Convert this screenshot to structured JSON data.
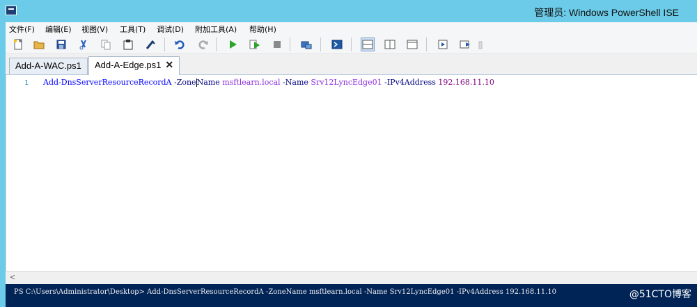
{
  "window": {
    "title": "管理员: Windows PowerShell ISE"
  },
  "menu": [
    {
      "label": "文件(F)"
    },
    {
      "label": "编辑(E)"
    },
    {
      "label": "视图(V)"
    },
    {
      "label": "工具(T)"
    },
    {
      "label": "调试(D)"
    },
    {
      "label": "附加工具(A)"
    },
    {
      "label": "帮助(H)"
    }
  ],
  "toolbar": {
    "icons": [
      "new-icon",
      "open-icon",
      "save-icon",
      "cut-icon",
      "copy-icon",
      "paste-icon",
      "clear-icon",
      "undo-icon",
      "redo-icon",
      "run-icon",
      "run-selection-icon",
      "stop-icon",
      "remote-icon",
      "powershell-icon",
      "layout-top-icon",
      "layout-right-icon",
      "layout-max-icon",
      "command-addon-icon",
      "show-script-icon"
    ]
  },
  "tabs": [
    {
      "label": "Add-A-WAC.ps1",
      "active": false
    },
    {
      "label": "Add-A-Edge.ps1",
      "active": true,
      "close": "✕"
    }
  ],
  "editor": {
    "line_number": "1",
    "tokens": {
      "cmd": "Add-DnsServerResourceRecordA",
      "p1a": "-Zone",
      "p1b": "Name",
      "a1": "msftlearn.local",
      "p2": "-Name",
      "a2": "Srv12LyncEdge01",
      "p3": "-IPv4Address",
      "a3": "192.168.11.10"
    }
  },
  "scrollbar": {
    "left_arrow": "<"
  },
  "console": {
    "line": "PS C:\\Users\\Administrator\\Desktop> Add-DnsServerResourceRecordA -ZoneName msftlearn.local -Name Srv12LyncEdge01 -IPv4Address 192.168.11.10",
    "watermark": "@51CTO博客"
  }
}
